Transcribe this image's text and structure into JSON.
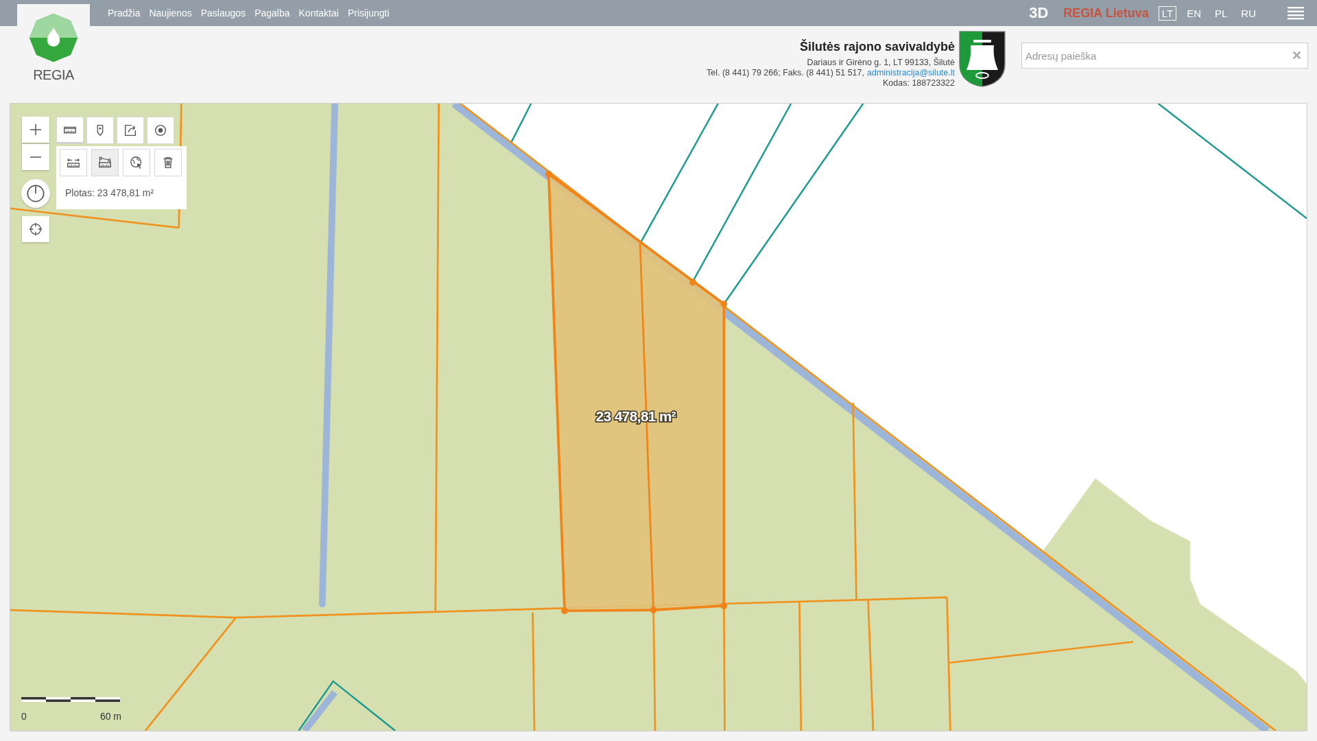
{
  "nav": [
    "Pradžia",
    "Naujienos",
    "Paslaugos",
    "Pagalba",
    "Kontaktai",
    "Prisijungti"
  ],
  "brand_3d": "3D",
  "brand": "REGIA Lietuva",
  "languages": [
    {
      "label": "LT",
      "selected": true
    },
    {
      "label": "EN",
      "selected": false
    },
    {
      "label": "PL",
      "selected": false
    },
    {
      "label": "RU",
      "selected": false
    }
  ],
  "logo_text": "REGIA",
  "municipality": {
    "name": "Šilutės rajono savivaldybė",
    "address": "Dariaus ir Girėno g. 1, LT 99133, Šilutė",
    "contacts": "Tel. (8 441) 79 266; Faks. (8 441) 51 517,",
    "email": "administracija@silute.lt",
    "code": "Kodas: 188723322"
  },
  "search": {
    "placeholder": "Adresų paieška"
  },
  "map_tools": [
    {
      "kind": "ruler",
      "selected": true
    },
    {
      "kind": "pin",
      "selected": false
    },
    {
      "kind": "share",
      "selected": false
    },
    {
      "kind": "target",
      "selected": false
    }
  ],
  "measure_tools": [
    {
      "kind": "distance",
      "selected": false
    },
    {
      "kind": "area",
      "selected": true
    },
    {
      "kind": "globe",
      "selected": false
    },
    {
      "kind": "trash",
      "selected": false
    }
  ],
  "area_readout": "Plotas: 23 478,81 m²",
  "parcel_label": "23 478,81 m²",
  "scale": {
    "start": "0",
    "end": "60 m"
  }
}
